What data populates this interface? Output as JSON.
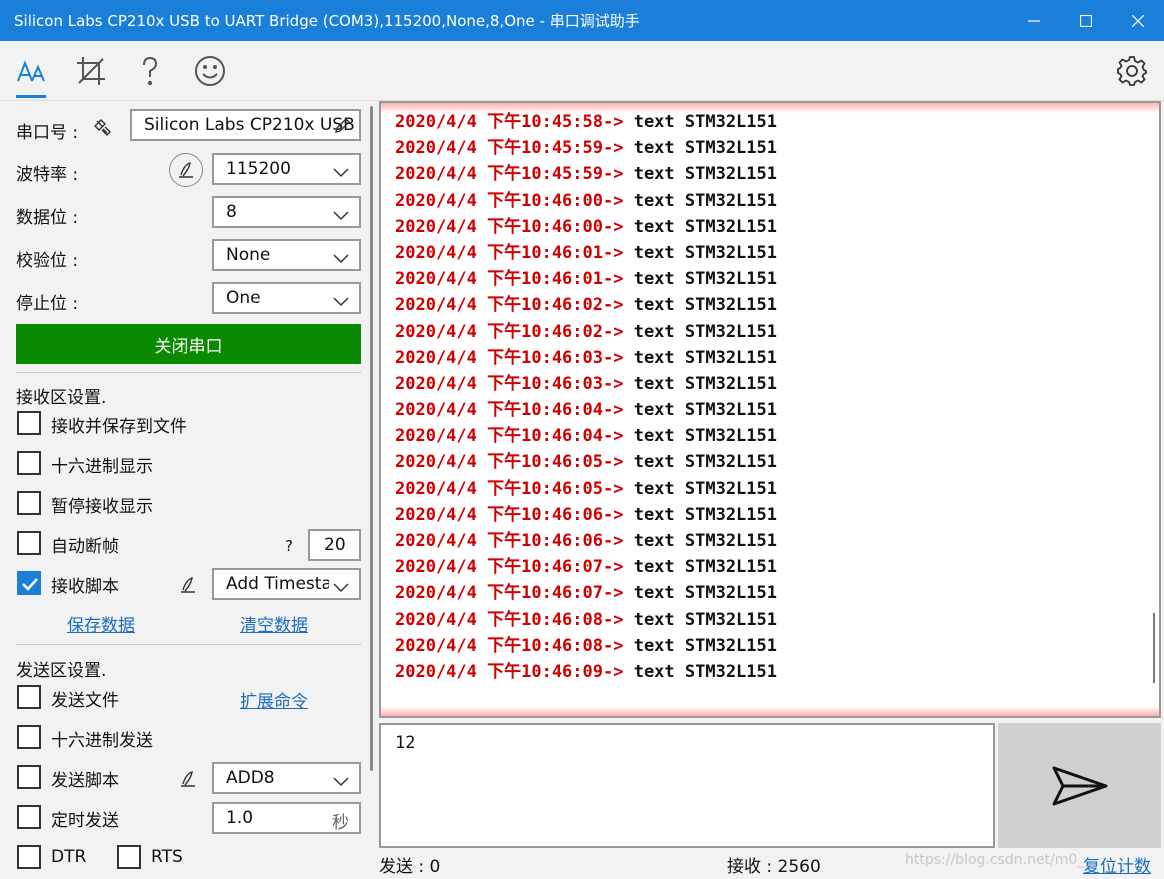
{
  "window": {
    "title": "Silicon Labs CP210x USB to UART Bridge (COM3),115200,None,8,One - 串口调试助手"
  },
  "toolbar": {
    "tools": [
      "font-icon",
      "crop-icon",
      "help-icon",
      "smiley-icon"
    ],
    "settings": "gear-icon"
  },
  "port": {
    "port_label": "串口号 :",
    "port_value": "Silicon Labs CP210x USB",
    "baud_label": "波特率 :",
    "baud_value": "115200",
    "data_label": "数据位 :",
    "data_value": "8",
    "parity_label": "校验位 :",
    "parity_value": "None",
    "stop_label": "停止位 :",
    "stop_value": "One",
    "close_button": "关闭串口"
  },
  "receive_settings": {
    "heading": "接收区设置.",
    "save_to_file": "接收并保存到文件",
    "hex_display": "十六进制显示",
    "pause_display": "暂停接收显示",
    "auto_frame": "自动断帧",
    "auto_frame_help": "?",
    "auto_frame_value": "20",
    "rx_script": "接收脚本",
    "rx_script_checked": true,
    "rx_script_value": "Add Timesta",
    "save_data": "保存数据",
    "clear_data": "清空数据"
  },
  "send_settings": {
    "heading": "发送区设置.",
    "send_file": "发送文件",
    "ext_command": "扩展命令",
    "hex_send": "十六进制发送",
    "tx_script": "发送脚本",
    "tx_script_value": "ADD8",
    "timed_send": "定时发送",
    "timed_value": "1.0",
    "timed_unit": "秒",
    "dtr": "DTR",
    "rts": "RTS"
  },
  "receive_lines": [
    {
      "ts": "2020/4/4 下午10:45:58->",
      "msg": " text STM32L151"
    },
    {
      "ts": "2020/4/4 下午10:45:59->",
      "msg": " text STM32L151"
    },
    {
      "ts": "2020/4/4 下午10:45:59->",
      "msg": " text STM32L151"
    },
    {
      "ts": "2020/4/4 下午10:46:00->",
      "msg": " text STM32L151"
    },
    {
      "ts": "2020/4/4 下午10:46:00->",
      "msg": " text STM32L151"
    },
    {
      "ts": "2020/4/4 下午10:46:01->",
      "msg": " text STM32L151"
    },
    {
      "ts": "2020/4/4 下午10:46:01->",
      "msg": " text STM32L151"
    },
    {
      "ts": "2020/4/4 下午10:46:02->",
      "msg": " text STM32L151"
    },
    {
      "ts": "2020/4/4 下午10:46:02->",
      "msg": " text STM32L151"
    },
    {
      "ts": "2020/4/4 下午10:46:03->",
      "msg": " text STM32L151"
    },
    {
      "ts": "2020/4/4 下午10:46:03->",
      "msg": " text STM32L151"
    },
    {
      "ts": "2020/4/4 下午10:46:04->",
      "msg": " text STM32L151"
    },
    {
      "ts": "2020/4/4 下午10:46:04->",
      "msg": " text STM32L151"
    },
    {
      "ts": "2020/4/4 下午10:46:05->",
      "msg": " text STM32L151"
    },
    {
      "ts": "2020/4/4 下午10:46:05->",
      "msg": " text STM32L151"
    },
    {
      "ts": "2020/4/4 下午10:46:06->",
      "msg": " text STM32L151"
    },
    {
      "ts": "2020/4/4 下午10:46:06->",
      "msg": " text STM32L151"
    },
    {
      "ts": "2020/4/4 下午10:46:07->",
      "msg": " text STM32L151"
    },
    {
      "ts": "2020/4/4 下午10:46:07->",
      "msg": " text STM32L151"
    },
    {
      "ts": "2020/4/4 下午10:46:08->",
      "msg": " text STM32L151"
    },
    {
      "ts": "2020/4/4 下午10:46:08->",
      "msg": " text STM32L151"
    },
    {
      "ts": "2020/4/4 下午10:46:09->",
      "msg": " text STM32L151"
    }
  ],
  "send_text": "12",
  "status": {
    "sent": "发送 : 0",
    "received": "接收 : 2560",
    "reset": "复位计数",
    "watermark": "https://blog.csdn.net/m0_"
  },
  "colors": {
    "titlebar": "#1a7fd9",
    "timestamp": "#d00000",
    "close_button": "#0a8a00",
    "link": "#1a6dc0"
  }
}
